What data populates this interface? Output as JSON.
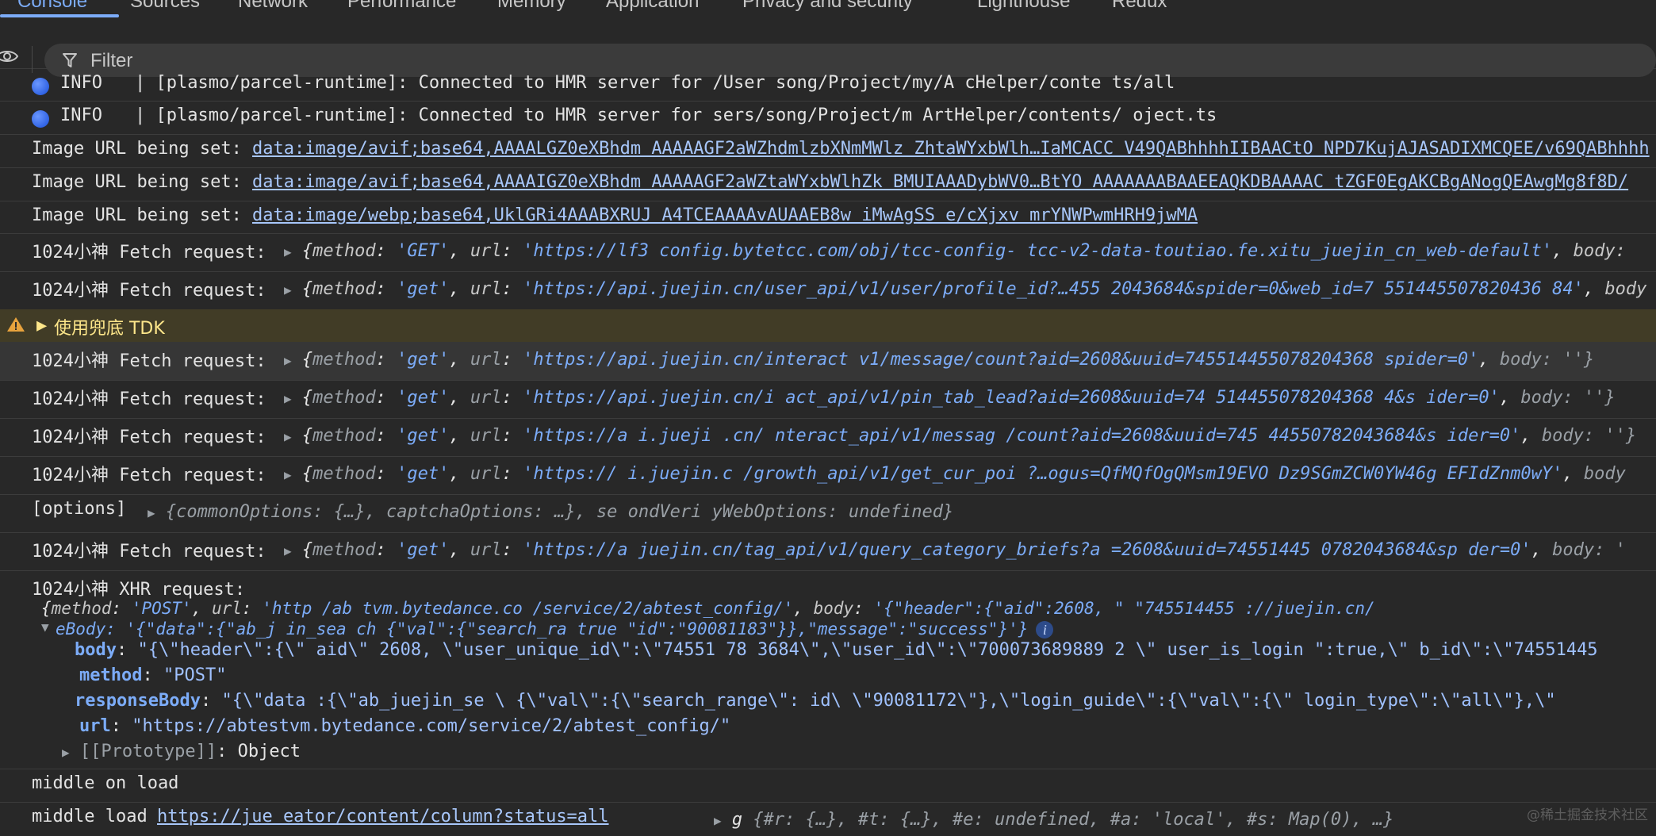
{
  "tabs": [
    "Console",
    "Sources",
    "Network",
    "Performance",
    "Memory",
    "Application",
    "Privacy and security",
    "Lighthouse",
    "Redux"
  ],
  "filter": {
    "placeholder": "Filter"
  },
  "logs": {
    "l1": {
      "level": "INFO",
      "text": "| [plasmo/parcel-runtime]: Connected to HMR server for /User  song/Project/my/A  cHelper/conte  ts/all"
    },
    "l2": {
      "level": "INFO",
      "text": "| [plasmo/parcel-runtime]: Connected to HMR server for  sers/song/Project/m  ArtHelper/contents/  oject.ts"
    },
    "l3": {
      "prefix": "Image URL being set:",
      "url": "data:image/avif;base64,AAAALGZ0eXBhdm  AAAAAGF2aWZhdmlzbXNmMWlz  ZhtaWYxbWlh…IaMCACC  V49QABhhhhIIBAACtO  NPD7KujAJASADIXMCQEE/v69QABhhhh"
    },
    "l4": {
      "prefix": "Image URL being set:",
      "url": "data:image/avif;base64,AAAAIGZ0eXBhdm  AAAAAGF2aWZtaWYxbWlhZk  BMUIAAADybWV0…BtYO  AAAAAAABAAEEAQKDBAAAAC  tZGF0EgAKCBgANogQEAwgMg8f8D/"
    },
    "l5": {
      "prefix": "Image URL being set:",
      "url": "data:image/webp;base64,UklGRi4AAABXRUJ  A4TCEAAAAvAUAAEB8w  iMwAgSS  e/cXjxv  mrYNWPwmHRH9jwMA"
    },
    "l6": {
      "prefix": "1024小神 Fetch request:",
      "method": "'GET'",
      "url": "'https://lf3  config.bytetcc.com/obj/tcc-config-  tcc-v2-data-toutiao.fe.xitu_juejin_cn_web-default'",
      "tail": "body:"
    },
    "l7": {
      "prefix": "1024小神 Fetch request:",
      "method": "'get'",
      "url": "'https://api.juejin.cn/user_api/v1/user/profile_id?…455  2043684&spider=0&web_id=7  551445507820436 84'",
      "tail": "body"
    },
    "warn": {
      "text": "使用兜底 TDK"
    },
    "l8": {
      "prefix": "1024小神 Fetch request:",
      "method": "'get'",
      "url": "'https://api.juejin.cn/interact  v1/message/count?aid=2608&uuid=745514455078204368  spider=0'",
      "tail": "body: ''}"
    },
    "l9": {
      "prefix": "1024小神 Fetch request:",
      "method": "'get'",
      "url": "'https://api.juejin.cn/i  act_api/v1/pin_tab_lead?aid=2608&uuid=74  514455078204368 4&s  ider=0'",
      "tail": "body: ''}"
    },
    "l10": {
      "prefix": "1024小神 Fetch request:",
      "method": "'get'",
      "url": "'https://a i.jueji  .cn/ nteract_api/v1/messag /count?aid=2608&uuid=745  44550782043684&s  ider=0'",
      "tail": "body: ''}"
    },
    "l11": {
      "prefix": "1024小神 Fetch request:",
      "method": "'get'",
      "url": "'https://  i.juejin.c /growth_api/v1/get_cur_poi  ?…ogus=QfMQfOgQMsm19EVO  Dz9SGmZCW0YW46g  EFIdZnm0wY'",
      "tail": "body"
    },
    "l12": {
      "prefix": "[options]",
      "obj": "{commonOptions: {…}, captchaOptions:  …}, se ondVeri  yWebOptions: undefined}"
    },
    "l13": {
      "prefix": "1024小神 Fetch request:",
      "method": "'get'",
      "url": "'https://a  juejin.cn/tag_api/v1/query_category_briefs?a  =2608&uuid=74551445  0782043684&sp  der=0'",
      "tail": "body: '"
    },
    "xhr": {
      "prefix": "1024小神 XHR request:",
      "summary_method": "'POST'",
      "summary_url": "'http  /ab  tvm.bytedance.co  /service/2/abtest_config/'",
      "summary_body": "'{\"header\":{\"aid\":2608,  \"  \"745514455  ://juejin.cn/",
      "summary_line2": "eBody: '{\"data\":{\"ab_j  in_sea ch  {\"val\":{\"search_ra   true \"id\":\"90081183\"}},\"message\":\"success\"}'}",
      "body": "\"{\\\"header\\\":{\\\" aid\\\" 2608, \\\"user_unique_id\\\":\\\"74551   78  3684\\\",\\\"user_id\\\":\\\"700073689889 2  \\\"  user_is_login  \":true,\\\"  b_id\\\":\\\"74551445",
      "method": "\"POST\"",
      "responseBody": "\"{\\\"data  :{\\\"ab_juejin_se     \\  {\\\"val\\\":{\\\"search_range\\\":    id\\  \\\"90081172\\\"},\\\"login_guide\\\":{\\\"val\\\":{\\\" login_type\\\":\\\"all\\\"},\\\"",
      "url": "\"https://abtestvm.bytedance.com/service/2/abtest_config/\"",
      "prototype": "Object"
    },
    "l14": {
      "text": "middle on load"
    },
    "l15": {
      "prefix": "middle load",
      "url": "https://jue      eator/content/column?status=all",
      "obj_name": "g",
      "obj": "{#r: {…}, #t: {…}, #e: undefined, #a: 'local', #s: Map(0), …}"
    }
  },
  "watermark": "@稀土掘金技术社区"
}
